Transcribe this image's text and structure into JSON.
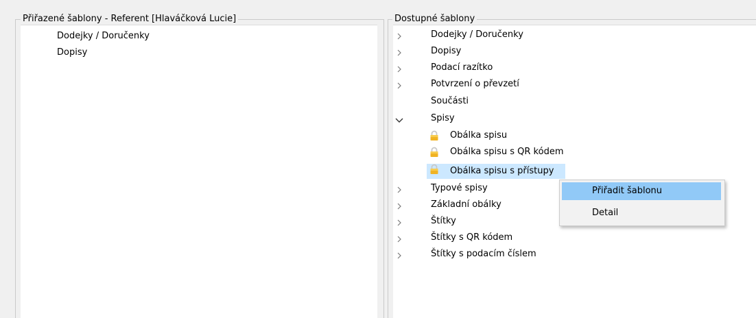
{
  "left_panel": {
    "title": "Přiřazené šablony - Referent [Hlaváčková Lucie]",
    "items": [
      "Dodejky / Doručenky",
      "Dopisy"
    ]
  },
  "right_panel": {
    "title": "Dostupné šablony",
    "items": [
      {
        "label": "Dodejky / Doručenky",
        "expander": "chevron-right"
      },
      {
        "label": "Dopisy",
        "expander": "chevron-right"
      },
      {
        "label": "Podací razítko",
        "expander": "chevron-right"
      },
      {
        "label": "Potvrzení o převzetí",
        "expander": "chevron-right"
      },
      {
        "label": "Součásti",
        "expander": "none"
      },
      {
        "label": "Spisy",
        "expander": "chevron-down"
      },
      {
        "label": "Obálka spisu",
        "icon": "lock-icon"
      },
      {
        "label": "Obálka spisu s QR kódem",
        "icon": "lock-icon"
      },
      {
        "label": "Obálka spisu s přístupy",
        "icon": "lock-icon",
        "selected": true
      },
      {
        "label": "Typové spisy",
        "expander": "chevron-right"
      },
      {
        "label": "Základní obálky",
        "expander": "chevron-right"
      },
      {
        "label": "Štítky",
        "expander": "chevron-right"
      },
      {
        "label": "Štítky s QR kódem",
        "expander": "chevron-right"
      },
      {
        "label": "Štítky s podacím číslem",
        "expander": "chevron-right"
      }
    ]
  },
  "context_menu": {
    "items": [
      "Přiřadit šablonu",
      "Detail"
    ],
    "highlighted": "Přiřadit šablonu"
  },
  "colors": {
    "selection": "#cce8ff",
    "menu_highlight": "#91c9f7",
    "lock": "#e8a317"
  }
}
